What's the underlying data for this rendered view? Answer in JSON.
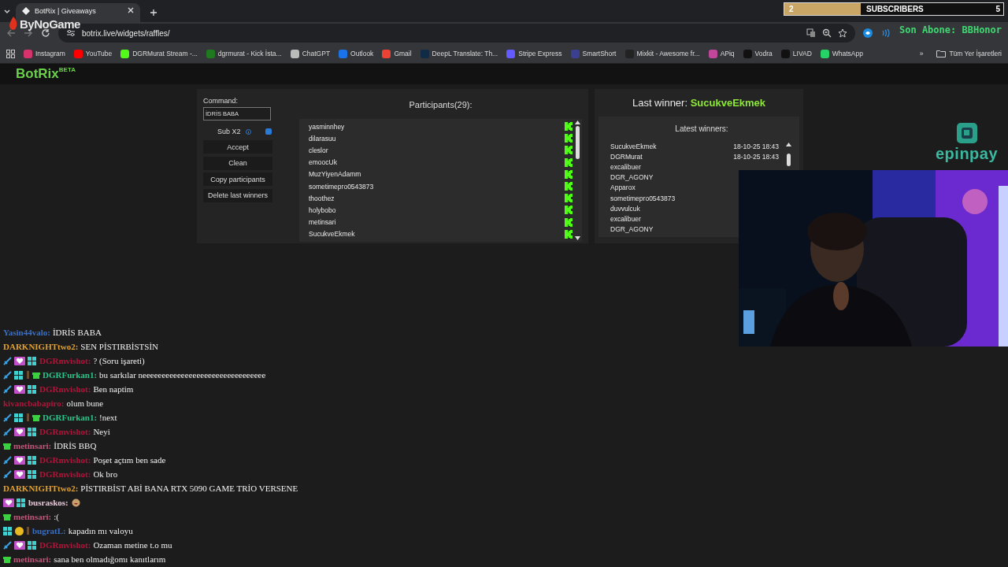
{
  "browser": {
    "tab": {
      "title": "BotRix | Giveaways"
    },
    "url": "botrix.live/widgets/raffles/",
    "bookmarks": [
      {
        "label": "Instagram",
        "color": "#d6336c"
      },
      {
        "label": "YouTube",
        "color": "#ff0000"
      },
      {
        "label": "DGRMurat Stream -...",
        "color": "#53fc18"
      },
      {
        "label": "dgrmurat - Kick İsta...",
        "color": "#1f7a1f"
      },
      {
        "label": "ChatGPT",
        "color": "#bbbbbb"
      },
      {
        "label": "Outlook",
        "color": "#1a73e8"
      },
      {
        "label": "Gmail",
        "color": "#ea4335"
      },
      {
        "label": "DeepL Translate: Th...",
        "color": "#0f2b46"
      },
      {
        "label": "Stripe Express",
        "color": "#635bff"
      },
      {
        "label": "SmartShort",
        "color": "#3b3f8f"
      },
      {
        "label": "Mixkit - Awesome fr...",
        "color": "#222222"
      },
      {
        "label": "APiq",
        "color": "#c2479b"
      },
      {
        "label": "Vodra",
        "color": "#111111"
      },
      {
        "label": "LIVAD",
        "color": "#111111"
      },
      {
        "label": "WhatsApp",
        "color": "#25d366"
      }
    ],
    "more": "»",
    "all_bookmarks": "Tüm Yer İşaretleri"
  },
  "overlays": {
    "sponsor": "ByNoGame",
    "subscribers": {
      "current": "2",
      "label": "SUBSCRIBERS",
      "goal": "5",
      "level": 0.35
    },
    "last_sub": "Son Abone: BBHonor",
    "brand": "epinpay"
  },
  "app": {
    "logo": "BotRix",
    "badge": "BETA"
  },
  "raffle": {
    "command_label": "Command:",
    "command": "İDRİS BABA",
    "sub_x2": {
      "label": "Sub X2",
      "checked": true
    },
    "buttons": [
      "Accept",
      "Clean",
      "Copy participants",
      "Delete last winners"
    ],
    "participants_title": "Participants(29):",
    "participants": [
      "yasminnhey",
      "dilarasuu",
      "cleslor",
      "emoocUk",
      "MuzYiyenAdamm",
      "sometimepro0543873",
      "thoothez",
      "holybobo",
      "metinsari",
      "SucukveEkmek"
    ]
  },
  "winners": {
    "last_label": "Last winner:",
    "last_name": "SucukveEkmek",
    "title": "Latest winners:",
    "rows": [
      {
        "name": "SucukveEkmek",
        "date": "18-10-25 18:43"
      },
      {
        "name": "DGRMurat",
        "date": "18-10-25 18:43"
      },
      {
        "name": "excalibuer"
      },
      {
        "name": "DGR_AGONY"
      },
      {
        "name": "Apparox"
      },
      {
        "name": "sometimepro0543873"
      },
      {
        "name": "duvvulcuk"
      },
      {
        "name": "excalibuer"
      },
      {
        "name": "DGR_AGONY"
      }
    ]
  },
  "chat": [
    {
      "user": "Yasin44valo:",
      "color": "#3a6fc4",
      "text": "İDRİS BABA"
    },
    {
      "user": "DARKNIGHTtwo2:",
      "color": "#e0a030",
      "text": "SEN PİSTIRBİSTSİN"
    },
    {
      "badges": [
        {
          "kind": "sword"
        },
        {
          "kind": "heart"
        },
        {
          "kind": "og"
        }
      ],
      "user": "DGRmvishot:",
      "color": "#b0153a",
      "text": "? (Soru işareti)"
    },
    {
      "badges": [
        {
          "kind": "sword"
        },
        {
          "kind": "og"
        },
        {
          "kind": "pin"
        },
        {
          "kind": "gift"
        }
      ],
      "user": "DGRFurkan1:",
      "color": "#2bc48a",
      "text": "bu sarkılar neeeeeeeeeeeeeeeeeeeeeeeeeeeeeeee"
    },
    {
      "badges": [
        {
          "kind": "sword"
        },
        {
          "kind": "heart"
        },
        {
          "kind": "og"
        }
      ],
      "user": "DGRmvishot:",
      "color": "#b0153a",
      "text": "Ben naptim"
    },
    {
      "user": "kivancbabapiro:",
      "color": "#b0153a",
      "text": "olum bune"
    },
    {
      "badges": [
        {
          "kind": "sword"
        },
        {
          "kind": "og"
        },
        {
          "kind": "pin"
        },
        {
          "kind": "gift"
        }
      ],
      "user": "DGRFurkan1:",
      "color": "#2bc48a",
      "text": "!next"
    },
    {
      "badges": [
        {
          "kind": "sword"
        },
        {
          "kind": "heart"
        },
        {
          "kind": "og"
        }
      ],
      "user": "DGRmvishot:",
      "color": "#b0153a",
      "text": "Neyi"
    },
    {
      "badges": [
        {
          "kind": "gift"
        }
      ],
      "user": "metinsari:",
      "color": "#c0567a",
      "text": "İDRİS BBQ"
    },
    {
      "badges": [
        {
          "kind": "sword"
        },
        {
          "kind": "heart"
        },
        {
          "kind": "og"
        }
      ],
      "user": "DGRmvishot:",
      "color": "#b0153a",
      "text": "Poşet açtım ben sade"
    },
    {
      "badges": [
        {
          "kind": "sword"
        },
        {
          "kind": "heart"
        },
        {
          "kind": "og"
        }
      ],
      "user": "DGRmvishot:",
      "color": "#b0153a",
      "text": "Ok bro"
    },
    {
      "user": "DARKNIGHTtwo2:",
      "color": "#e0a030",
      "text": "PİSTIRBİST ABİ BANA RTX 5090 GAME TRİO VERSENE"
    },
    {
      "badges": [
        {
          "kind": "heart"
        },
        {
          "kind": "og"
        }
      ],
      "user": "busraskos:",
      "color": "#e8c8d8",
      "emote": true
    },
    {
      "badges": [
        {
          "kind": "gift"
        }
      ],
      "user": "metinsari:",
      "color": "#c0567a",
      "text": ":("
    },
    {
      "badges": [
        {
          "kind": "og"
        },
        {
          "kind": "coin"
        },
        {
          "kind": "pin"
        }
      ],
      "user": "bugratL:",
      "color": "#3a6fc4",
      "text": "kapadın mı valoyu"
    },
    {
      "badges": [
        {
          "kind": "sword"
        },
        {
          "kind": "heart"
        },
        {
          "kind": "og"
        }
      ],
      "user": "DGRmvishot:",
      "color": "#b0153a",
      "text": "Ozaman metine t.o mu"
    },
    {
      "badges": [
        {
          "kind": "gift"
        }
      ],
      "user": "metinsari:",
      "color": "#c0567a",
      "text": "sana ben olmadığomı kanıtlarım"
    }
  ]
}
